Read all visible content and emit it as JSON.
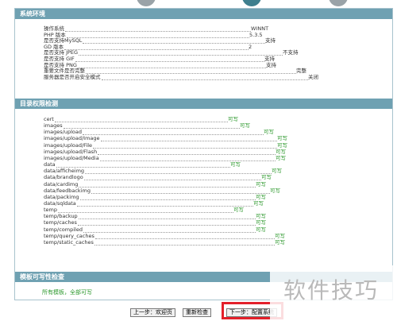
{
  "sections": {
    "env": {
      "title": "系统环境",
      "rows": [
        {
          "label": "操作系统",
          "value": "WINNT"
        },
        {
          "label": "PHP 版本",
          "value": "5.3.5"
        },
        {
          "label": "是否支持MySQL",
          "value": "支持"
        },
        {
          "label": "GD 版本",
          "value": "2"
        },
        {
          "label": "是否支持 JPEG",
          "value": "不支持"
        },
        {
          "label": "是否支持 GIF",
          "value": "支持"
        },
        {
          "label": "是否支持 PNG",
          "value": "支持"
        },
        {
          "label": "重要文件是否完整",
          "value": "完整"
        },
        {
          "label": "服务器是否开启安全模式",
          "value": "关闭"
        }
      ]
    },
    "perm": {
      "title": "目录权限检测",
      "rows": [
        {
          "label": "cert",
          "value": "可写"
        },
        {
          "label": "images",
          "value": "可写"
        },
        {
          "label": "images/upload",
          "value": "可写"
        },
        {
          "label": "images/upload/Image",
          "value": "可写"
        },
        {
          "label": "images/upload/File",
          "value": "可写"
        },
        {
          "label": "images/upload/Flash",
          "value": "可写"
        },
        {
          "label": "images/upload/Media",
          "value": "可写"
        },
        {
          "label": "data",
          "value": "可写"
        },
        {
          "label": "data/afficheimg",
          "value": "可写"
        },
        {
          "label": "data/brandlogo",
          "value": "可写"
        },
        {
          "label": "data/cardimg",
          "value": "可写"
        },
        {
          "label": "data/feedbackimg",
          "value": "可写"
        },
        {
          "label": "data/packimg",
          "value": "可写"
        },
        {
          "label": "data/sqldata",
          "value": "可写"
        },
        {
          "label": "temp",
          "value": "可写"
        },
        {
          "label": "temp/backup",
          "value": "可写"
        },
        {
          "label": "temp/caches",
          "value": "可写"
        },
        {
          "label": "temp/compiled",
          "value": "可写"
        },
        {
          "label": "temp/query_caches",
          "value": "可写"
        },
        {
          "label": "temp/static_caches",
          "value": "可写"
        }
      ]
    },
    "tpl": {
      "title": "模板可写性检查",
      "summary": "所有模板，全部可写"
    }
  },
  "buttons": {
    "prev": "上一步：欢迎页",
    "recheck": "重新检查",
    "next": "下一步：配置系统"
  },
  "watermark": "软件技巧",
  "colors": {
    "header_bg": "#6fa1b2",
    "ok_text": "#2f9a2f",
    "highlight": "#e3202a"
  }
}
